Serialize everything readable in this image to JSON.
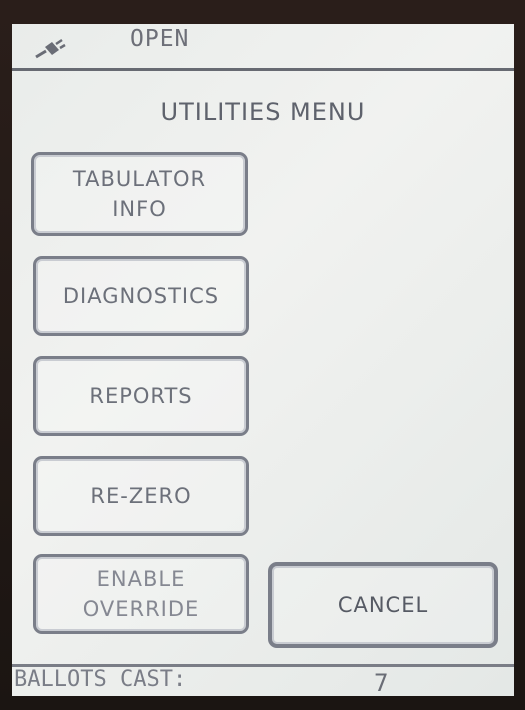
{
  "status": {
    "icon": "power-plug-icon",
    "text": "OPEN"
  },
  "menu": {
    "title": "UTILITIES MENU",
    "buttons": {
      "tabulator_info": [
        "TABULATOR",
        "INFO"
      ],
      "diagnostics": "DIAGNOSTICS",
      "reports": "REPORTS",
      "re_zero": "RE-ZERO",
      "enable_override": [
        "ENABLE",
        "OVERRIDE"
      ],
      "cancel": "CANCEL"
    }
  },
  "footer": {
    "ballots_cast_label": "BALLOTS CAST:",
    "ballots_cast_value": "7"
  },
  "colors": {
    "screen_background": "#eceeec",
    "button_border": "#7a7e89",
    "text": "#6c707a",
    "bezel": "#1b1512"
  }
}
